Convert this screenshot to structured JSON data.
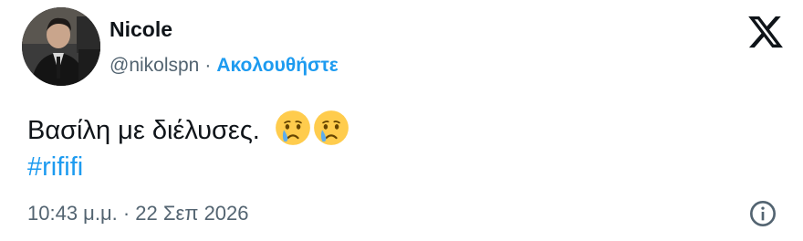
{
  "author": {
    "name": "Nicole",
    "handle": "@nikolspn",
    "separator": "·",
    "follow_label": "Ακολουθήστε"
  },
  "icons": {
    "avatar": "profile-photo",
    "logo": "x-logo-icon",
    "emoji": "crying-face-emoji",
    "info": "info-icon"
  },
  "tweet": {
    "text": "Βασίλη με διέλυσες.",
    "hashtag": "#rififi",
    "timestamp": "10:43 μ.μ. · 22 Σεπ 2026"
  },
  "colors": {
    "accent": "#1d9bf0",
    "text": "#0f1419",
    "muted": "#536471"
  }
}
